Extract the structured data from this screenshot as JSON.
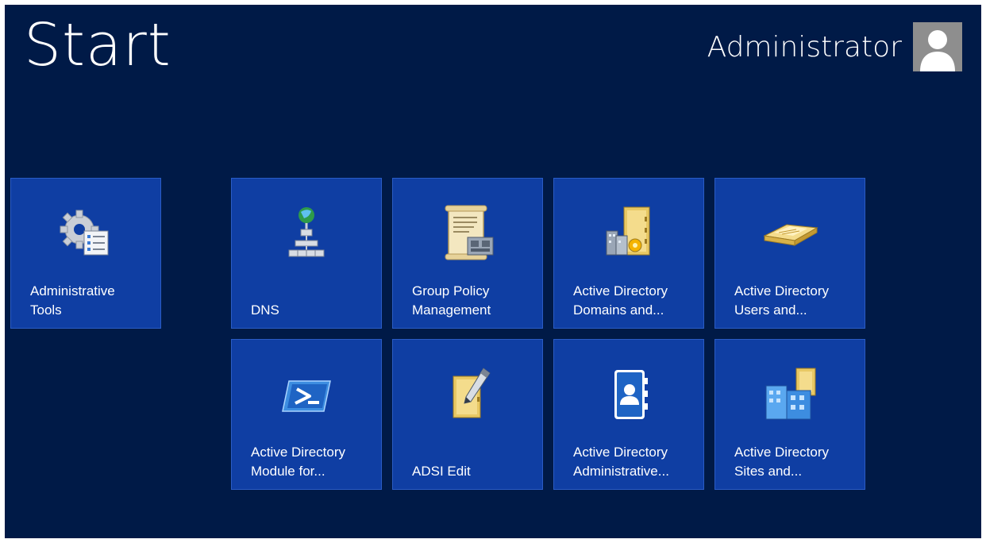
{
  "screen": {
    "title": "Start",
    "user_name": "Administrator"
  },
  "tiles": [
    {
      "label": "Administrative\nTools",
      "icon": "admin-tools-gear-icon"
    },
    {
      "label": "DNS",
      "icon": "dns-network-icon"
    },
    {
      "label": "Group Policy\nManagement",
      "icon": "group-policy-scroll-icon"
    },
    {
      "label": "Active Directory\nDomains and...",
      "icon": "ad-domains-trusts-icon"
    },
    {
      "label": "Active Directory\nUsers and...",
      "icon": "ad-users-computers-icon"
    },
    {
      "label": "Active Directory\nModule for...",
      "icon": "powershell-icon"
    },
    {
      "label": "ADSI Edit",
      "icon": "adsi-edit-icon"
    },
    {
      "label": "Active Directory\nAdministrative...",
      "icon": "ad-admin-center-icon"
    },
    {
      "label": "Active Directory\nSites and...",
      "icon": "ad-sites-services-icon"
    }
  ],
  "colors": {
    "background": "#001a47",
    "tile": "#0f3ea3",
    "text": "#ffffff"
  }
}
